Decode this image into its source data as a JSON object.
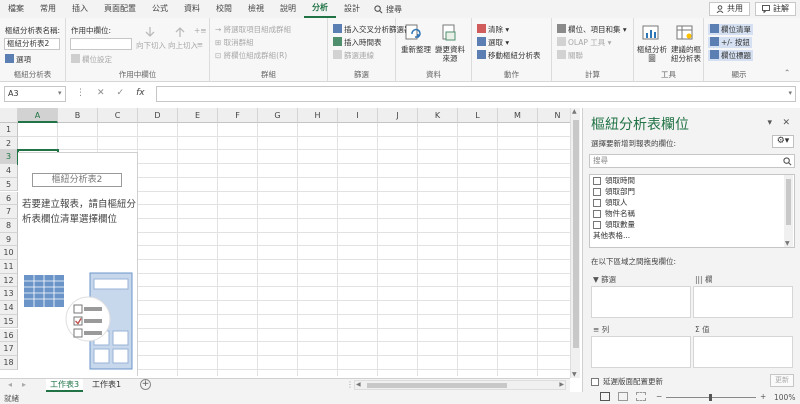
{
  "tabs": [
    "檔案",
    "常用",
    "插入",
    "頁面配置",
    "公式",
    "資料",
    "校閱",
    "檢視",
    "說明",
    "分析",
    "設計"
  ],
  "active_tab_index": 9,
  "search_label": "搜尋",
  "share_label": "共用",
  "comment_label": "註解",
  "ribbon": {
    "pivot_name_label": "樞紐分析表名稱:",
    "pivot_name_value": "樞紐分析表2",
    "options_label": "選項",
    "group_pivot": "樞紐分析表",
    "active_field_label": "作用中欄位:",
    "field_settings": "欄位設定",
    "drill_down": "向下切入",
    "drill_up": "向上切入",
    "group_active_field": "作用中欄位",
    "group_selection": "將選取項目組成群組",
    "ungroup": "取消群組",
    "group_field": "將欄位組成群組(R)",
    "group_group": "群組",
    "insert_slicer": "插入交叉分析篩選器",
    "insert_timeline": "插入時間表",
    "filter_connections": "篩選連線",
    "group_filter": "篩選",
    "refresh": "重新整理",
    "change_source": "變更資料來源",
    "group_data": "資料",
    "clear": "清除",
    "select": "選取",
    "move_pivot": "移動樞紐分析表",
    "group_actions": "動作",
    "fields_items": "欄位、項目和集",
    "olap_tools": "OLAP 工具",
    "relationships": "關聯",
    "group_calc": "計算",
    "pivot_chart": "樞紐分析圖",
    "recommended": "建議的樞紐分析表",
    "group_tools": "工具",
    "field_list": "欄位清單",
    "plus_minus": "+/- 按鈕",
    "field_headers": "欄位標題",
    "group_show": "顯示"
  },
  "name_box": "A3",
  "columns": [
    "A",
    "B",
    "C",
    "D",
    "E",
    "F",
    "G",
    "H",
    "I",
    "J",
    "K",
    "L",
    "M",
    "N"
  ],
  "rows": [
    "1",
    "2",
    "3",
    "4",
    "5",
    "6",
    "7",
    "8",
    "9",
    "10",
    "11",
    "12",
    "13",
    "14",
    "15",
    "16",
    "17",
    "18"
  ],
  "pivot_placeholder": {
    "name": "樞紐分析表2",
    "hint": "若要建立報表，請自樞紐分析表欄位清單選擇欄位"
  },
  "sheets": [
    "工作表3",
    "工作表1"
  ],
  "active_sheet_index": 0,
  "status_text": "就緒",
  "zoom_level": "100%",
  "pane": {
    "title": "樞紐分析表欄位",
    "subtitle": "選擇要新增到報表的欄位:",
    "search_placeholder": "搜尋",
    "fields": [
      "領取時間",
      "領取部門",
      "領取人",
      "物件名稱",
      "領取數量",
      "其他表格..."
    ],
    "drag_label": "在以下區域之間拖曳欄位:",
    "area_filter": "篩選",
    "area_columns": "欄",
    "area_rows": "列",
    "area_values": "值",
    "defer_label": "延遲版面配置更新",
    "update_label": "更新"
  }
}
